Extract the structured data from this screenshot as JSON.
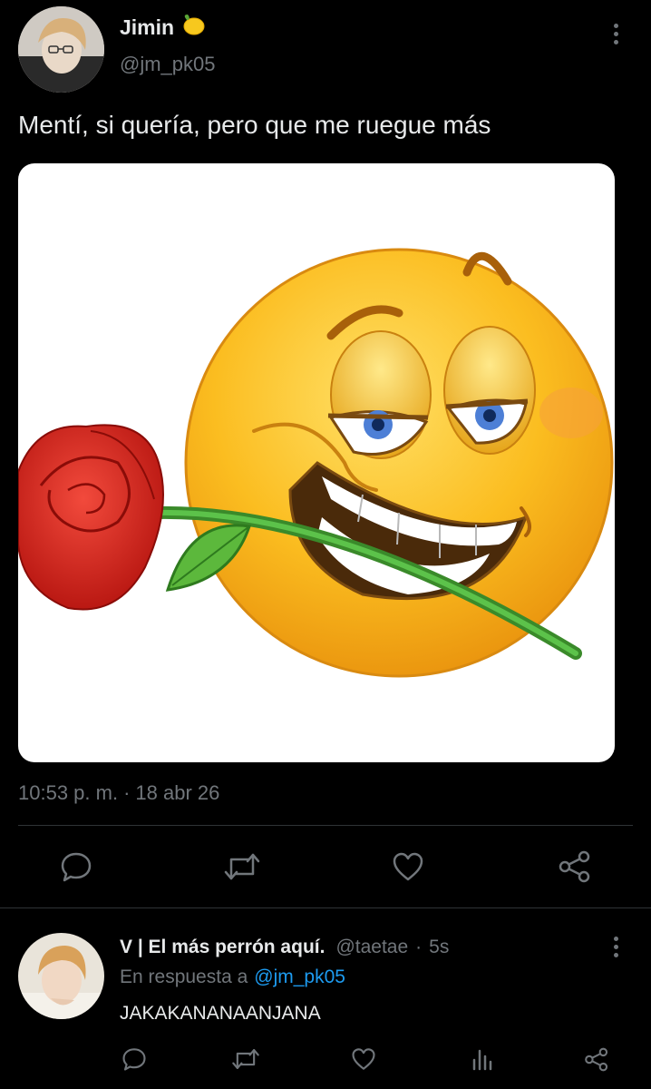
{
  "tweet": {
    "author_name": "Jimin",
    "name_emoji": "lemon-icon",
    "handle": "@jm_pk05",
    "text": "Mentí, si quería, pero que me ruegue más",
    "time": "10:53 p. m.",
    "separator": "·",
    "date": "18 abr 26",
    "actions": [
      "reply-icon",
      "retweet-icon",
      "like-icon",
      "share-icon"
    ]
  },
  "reply": {
    "author_name": "V | El más perrón aquí.",
    "handle": "@taetae",
    "separator": "·",
    "age": "5s",
    "replying_prefix": "En respuesta a",
    "replying_to": "@jm_pk05",
    "text": "JAKAKANANAANJANA",
    "actions": [
      "reply-icon",
      "retweet-icon",
      "like-icon",
      "views-icon",
      "share-icon"
    ]
  },
  "colors": {
    "background": "#000000",
    "text": "#e7e9ea",
    "muted": "#71767b",
    "link": "#1d9bf0",
    "divider": "#2f3336"
  }
}
